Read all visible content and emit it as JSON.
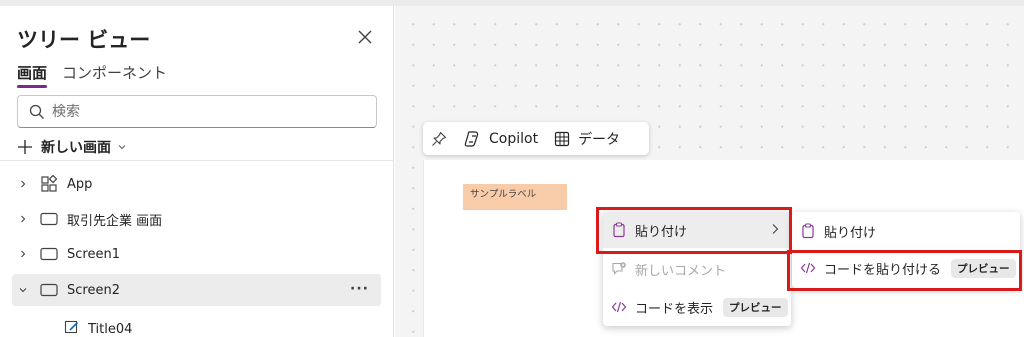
{
  "tree_panel": {
    "title": "ツリー ビュー",
    "tabs": [
      {
        "label": "画面",
        "active": true
      },
      {
        "label": "コンポーネント",
        "active": false
      }
    ],
    "search": {
      "placeholder": "検索",
      "value": ""
    },
    "new_screen": {
      "label": "新しい画面"
    },
    "items": [
      {
        "label": "App",
        "icon": "app-icon",
        "expanded": false
      },
      {
        "label": "取引先企業 画面",
        "icon": "screen-icon",
        "expanded": false
      },
      {
        "label": "Screen1",
        "icon": "screen-icon",
        "expanded": false
      },
      {
        "label": "Screen2",
        "icon": "screen-icon",
        "expanded": true,
        "selected": true,
        "more": "···"
      }
    ],
    "child_item": {
      "label": "Title04",
      "icon": "edit-label-icon"
    }
  },
  "canvas": {
    "toolbar": {
      "pin_icon": "pin-icon",
      "copilot_label": "Copilot",
      "data_label": "データ"
    },
    "sample_label": "サンプルラベル"
  },
  "context_menu": {
    "items": [
      {
        "label": "貼り付け",
        "icon": "clipboard-icon",
        "submenu": true,
        "highlighted": true
      },
      {
        "label": "新しいコメント",
        "icon": "comment-add-icon",
        "disabled": true
      },
      {
        "label": "コードを表示",
        "icon": "code-icon",
        "badge": "プレビュー"
      }
    ]
  },
  "submenu": {
    "items": [
      {
        "label": "貼り付け",
        "icon": "clipboard-icon"
      },
      {
        "label": "コードを貼り付ける",
        "icon": "code-icon",
        "badge": "プレビュー"
      }
    ]
  },
  "colors": {
    "accent": "#7a2a8a",
    "highlight_box": "#d91a1a",
    "sample_label_bg": "#f8cba9"
  }
}
